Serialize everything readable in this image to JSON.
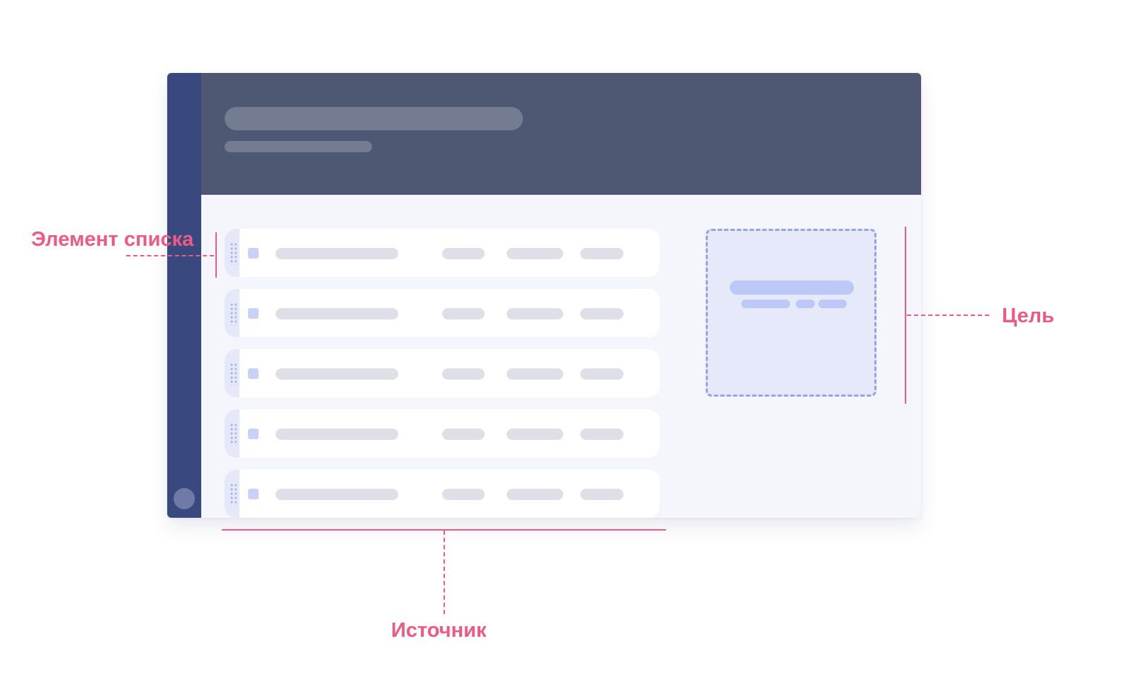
{
  "annotations": {
    "list_item": "Элемент списка",
    "target": "Цель",
    "source": "Источник"
  },
  "list": {
    "item_count": 5
  },
  "colors": {
    "annotation": "#ef5a82",
    "sidebar": "#3a4880",
    "header": "#4f5872",
    "content_bg": "#f5f6fb",
    "target_border": "#94a4e6",
    "target_fill": "#e6e9fa"
  }
}
